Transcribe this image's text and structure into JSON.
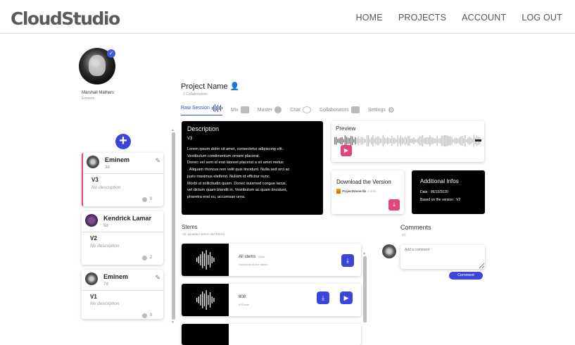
{
  "header": {
    "logo": "CloudStudio",
    "nav": [
      "HOME",
      "PROJECTS",
      "ACCOUNT",
      "LOG OUT"
    ]
  },
  "profile": {
    "name": "Marshall Mathers",
    "nickname": "Eminem",
    "verified_icon": "check-icon"
  },
  "versions": [
    {
      "artist": "Eminem",
      "date": "3d",
      "version": "V3",
      "description": "No description",
      "comments": "0",
      "editable": true
    },
    {
      "artist": "Kendrick Lamar",
      "date": "5d",
      "version": "V2",
      "description": "No description",
      "comments": "2",
      "editable": false
    },
    {
      "artist": "Eminem",
      "date": "7d",
      "version": "V1",
      "description": "No description",
      "comments": "0",
      "editable": true
    }
  ],
  "project": {
    "title": "Project Name",
    "collaborators": "2 Collaborators"
  },
  "tabs": [
    {
      "label": "Raw Session",
      "active": true
    },
    {
      "label": "Mix",
      "active": false
    },
    {
      "label": "Master",
      "active": false
    },
    {
      "label": "Chat",
      "active": false
    },
    {
      "label": "Collaborators",
      "active": false
    },
    {
      "label": "Settings",
      "active": false
    }
  ],
  "description_card": {
    "title": "Description",
    "version": "V3",
    "body": "Lorem ipsum dolor sit amet, consectetur adipiscing elit.\n Vestibulum condimentum ornare placerat.\nDonec vel sem id erat laoreet placerat a sit amet metus\n. Aliquam rhoncus non velit quis tincidunt. Nulla sed orci ac\n justo maximus eleifend. Nullam id efficitur nunc.\n Morbi ut sollicitudin quam. Donec euismod congue lacus,\nvel dictum quam blandit in. Vestibulum ac quam tincidunt,\n pharetra erat eu, accumsan urna."
  },
  "preview": {
    "title": "Preview"
  },
  "download": {
    "title": "Download the Version",
    "file": "ProjectName.flp",
    "file_size": "2.4mb"
  },
  "additional_info": {
    "title": "Additional Infos",
    "date": "Date : 06/10/2020",
    "based_on": "Based on the version : V2"
  },
  "stems": {
    "title": "Stems",
    "subtitle": "All uploaded stems and tracks",
    "items": [
      {
        "name": "All stems",
        "size": "32mo",
        "sub": "Download all the stems"
      },
      {
        "name": "808",
        "size": "",
        "sub": "808.wav"
      },
      {
        "name": "",
        "size": "",
        "sub": ""
      }
    ]
  },
  "comments": {
    "title": "Comments",
    "count": "(0)",
    "placeholder": "Add a comment",
    "button": "Comment"
  },
  "colors": {
    "accent": "#3b45d9",
    "pink": "#e0457b"
  }
}
